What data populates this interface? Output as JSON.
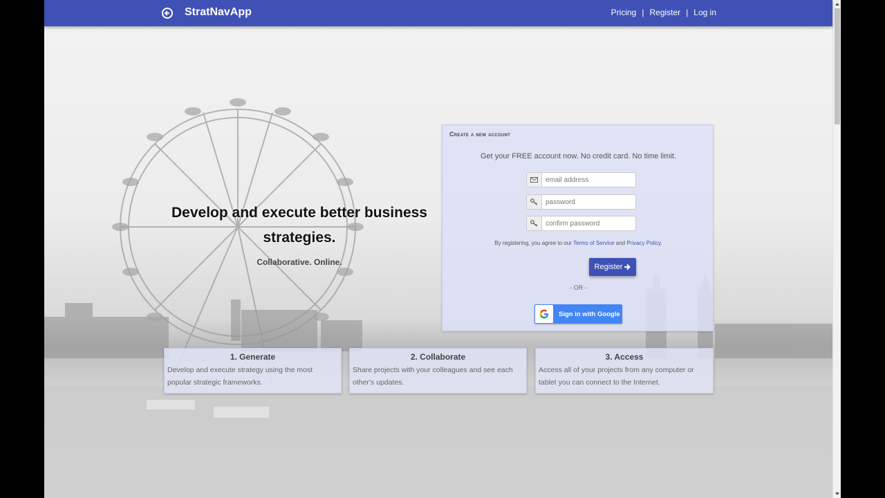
{
  "navbar": {
    "brand": "StratNavApp",
    "links": [
      "Pricing",
      "Register",
      "Log in"
    ],
    "separator": "|",
    "color": "#3f51b5"
  },
  "hero": {
    "title_line1": "Develop and execute better business",
    "title_line2": "strategies.",
    "subtitle": "Collaborative. Online."
  },
  "register_card": {
    "title": "Create a new account",
    "subtitle": "Get your FREE account now. No credit card. No time limit.",
    "email_placeholder": "email address",
    "password_placeholder": "password",
    "confirm_placeholder": "confirm password",
    "terms_prefix": "By registering, you agree to our ",
    "terms_link": "Terms of Service",
    "terms_and": " and ",
    "privacy_link": "Privacy Policy",
    "terms_suffix": ".",
    "register_label": "Register",
    "or_text": "- OR -",
    "google_label": "Sign in with Google"
  },
  "features": [
    {
      "title": "1. Generate",
      "text": "Develop and execute strategy using the most popular strategic frameworks."
    },
    {
      "title": "2. Collaborate",
      "text": "Share projects with your colleagues and see each other's updates."
    },
    {
      "title": "3. Access",
      "text": "Access all of your projects from any computer or tablet you can connect to the Internet."
    }
  ],
  "icons": {
    "brand": "back-arrow-circle-icon",
    "email": "envelope-icon",
    "password": "key-icon",
    "confirm": "key-icon",
    "register": "arrow-right-icon",
    "google": "google-g-icon"
  }
}
